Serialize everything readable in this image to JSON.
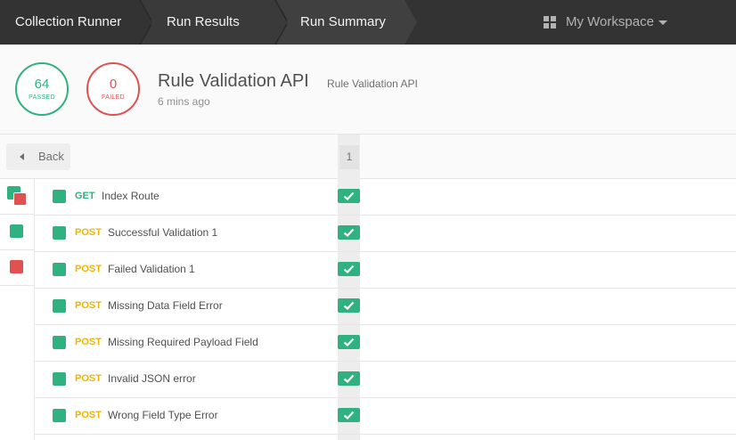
{
  "breadcrumbs": [
    {
      "label": "Collection Runner"
    },
    {
      "label": "Run Results"
    },
    {
      "label": "Run Summary"
    }
  ],
  "workspace": {
    "label": "My Workspace",
    "icon": "grid-icon"
  },
  "summary": {
    "passed": {
      "count": "64",
      "label": "PASSED"
    },
    "failed": {
      "count": "0",
      "label": "FAILED"
    },
    "title": "Rule Validation API",
    "collection": "Rule Validation API",
    "time": "6 mins ago"
  },
  "back": {
    "label": "Back"
  },
  "iteration": {
    "label": "1"
  },
  "colors": {
    "pass": "#2fb27f",
    "fail": "#e05252",
    "post": "#f0b400",
    "topbar": "#333333"
  },
  "requests": [
    {
      "method": "GET",
      "name": "Index Route",
      "status": "passed"
    },
    {
      "method": "POST",
      "name": "Successful Validation 1",
      "status": "passed"
    },
    {
      "method": "POST",
      "name": "Failed Validation 1",
      "status": "passed"
    },
    {
      "method": "POST",
      "name": "Missing Data Field Error",
      "status": "passed"
    },
    {
      "method": "POST",
      "name": "Missing Required Payload Field",
      "status": "passed"
    },
    {
      "method": "POST",
      "name": "Invalid JSON error",
      "status": "passed"
    },
    {
      "method": "POST",
      "name": "Wrong Field Type Error",
      "status": "passed"
    }
  ]
}
